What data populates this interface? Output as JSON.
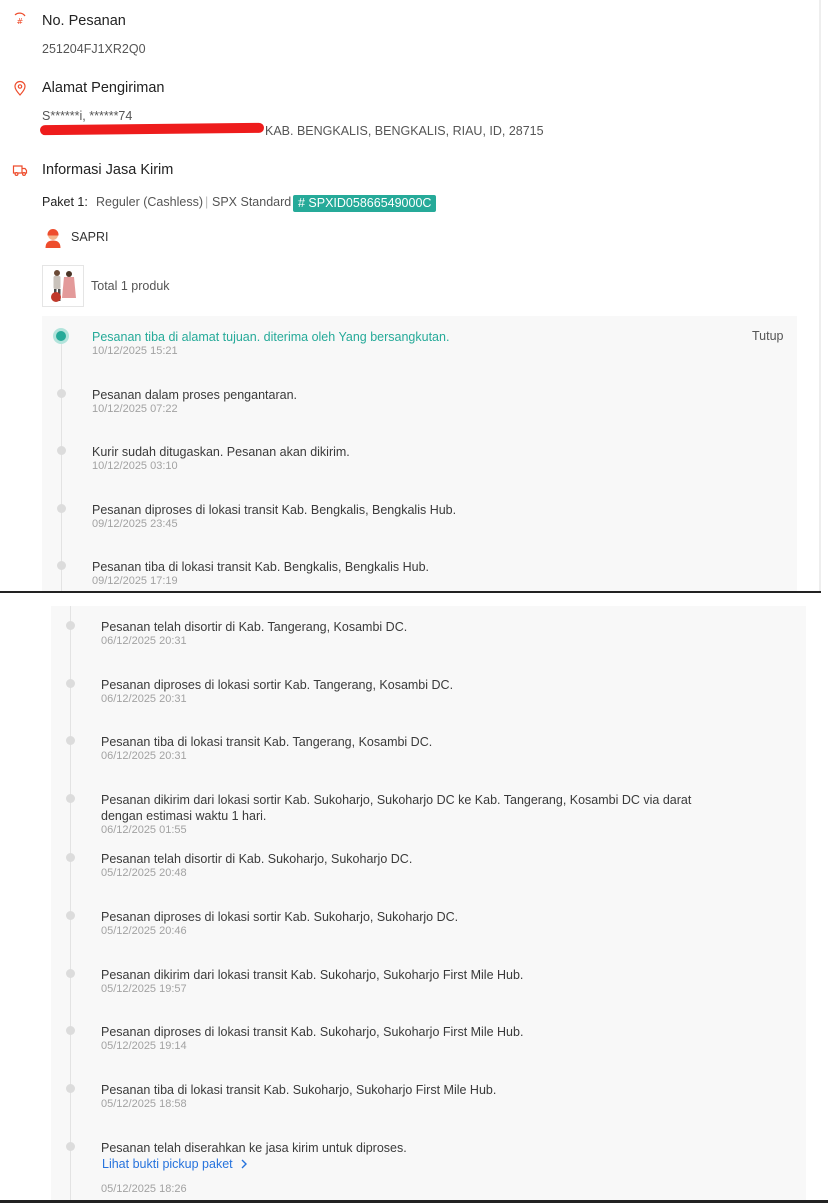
{
  "order": {
    "title": "No. Pesanan",
    "number": "251204FJ1XR2Q0"
  },
  "address": {
    "title": "Alamat Pengiriman",
    "recipient": "S******i, ******74",
    "line": "KAB. BENGKALIS, BENGKALIS, RIAU, ID, 28715"
  },
  "shipping": {
    "title": "Informasi Jasa Kirim",
    "package_label": "Paket 1:",
    "service": "Reguler (Cashless)",
    "separator": "|",
    "courier": "SPX Standard",
    "tracking_badge": "# SPXID05866549000C",
    "driver_name": "SAPRI",
    "total_products": "Total 1 produk",
    "collapse_label": "Tutup"
  },
  "timeline_top": [
    {
      "text": "Pesanan tiba di alamat tujuan. diterima oleh Yang bersangkutan.",
      "time": "10/12/2025 15:21"
    },
    {
      "text": "Pesanan dalam proses pengantaran.",
      "time": "10/12/2025 07:22"
    },
    {
      "text": "Kurir sudah ditugaskan. Pesanan akan dikirim.",
      "time": "10/12/2025 03:10"
    },
    {
      "text": "Pesanan diproses di lokasi transit Kab. Bengkalis, Bengkalis Hub.",
      "time": "09/12/2025 23:45"
    },
    {
      "text": "Pesanan tiba di lokasi transit Kab. Bengkalis, Bengkalis Hub.",
      "time": "09/12/2025 17:19"
    }
  ],
  "timeline_bottom": [
    {
      "text": "Pesanan telah disortir di Kab. Tangerang, Kosambi DC.",
      "time": "06/12/2025 20:31"
    },
    {
      "text": "Pesanan diproses di lokasi sortir Kab. Tangerang, Kosambi DC.",
      "time": "06/12/2025 20:31"
    },
    {
      "text": "Pesanan tiba di lokasi transit Kab. Tangerang, Kosambi DC.",
      "time": "06/12/2025 20:31"
    },
    {
      "text": "Pesanan dikirim dari lokasi sortir Kab. Sukoharjo, Sukoharjo DC ke Kab. Tangerang, Kosambi DC via darat",
      "text2": "dengan estimasi waktu 1 hari.",
      "time": "06/12/2025 01:55"
    },
    {
      "text": "Pesanan telah disortir di Kab. Sukoharjo, Sukoharjo DC.",
      "time": "05/12/2025 20:48"
    },
    {
      "text": "Pesanan diproses di lokasi sortir Kab. Sukoharjo, Sukoharjo DC.",
      "time": "05/12/2025 20:46"
    },
    {
      "text": "Pesanan dikirim dari lokasi transit Kab. Sukoharjo, Sukoharjo First Mile Hub.",
      "time": "05/12/2025 19:57"
    },
    {
      "text": "Pesanan diproses di lokasi transit Kab. Sukoharjo, Sukoharjo First Mile Hub.",
      "time": "05/12/2025 19:14"
    },
    {
      "text": "Pesanan tiba di lokasi transit Kab. Sukoharjo, Sukoharjo First Mile Hub.",
      "time": "05/12/2025 18:58"
    },
    {
      "text": "Pesanan telah diserahkan ke jasa kirim untuk diproses.",
      "link": "Lihat bukti pickup paket",
      "time": "05/12/2025 18:26"
    }
  ],
  "icons": {
    "order": "order-number-icon",
    "address": "location-pin-icon",
    "shipping": "truck-icon",
    "driver": "courier-avatar-icon",
    "link_arrow": "chevron-right-icon"
  },
  "colors": {
    "accent": "#26aa99",
    "brand": "#ee4d2d",
    "link": "#2673dd"
  }
}
